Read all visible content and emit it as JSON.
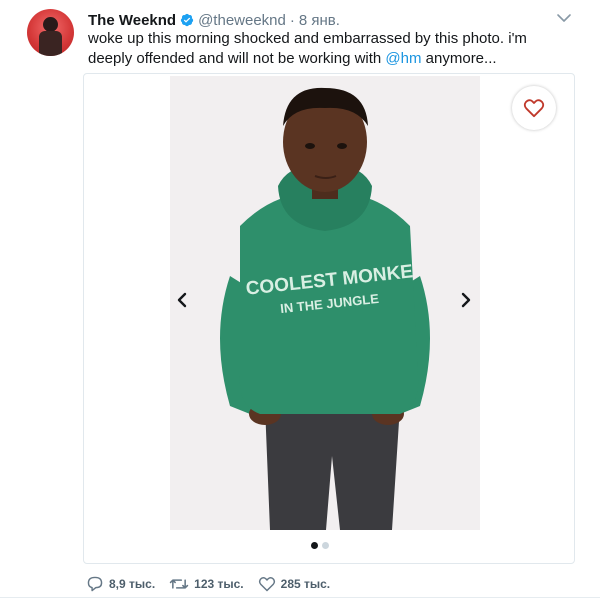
{
  "tweet": {
    "author_name": "The Weeknd",
    "handle": "@theweeknd",
    "separator": "·",
    "date": "8 янв.",
    "text_before": "woke up this morning shocked and embarrassed by this photo. i'm deeply offended and will not be working with ",
    "mention": "@hm",
    "text_after": " anymore..."
  },
  "media": {
    "hoodie_line1": "COOLEST MONKE",
    "hoodie_line2": "IN THE JUNGLE",
    "pages": 2,
    "current_page": 1
  },
  "actions": {
    "replies": "8,9 тыс.",
    "retweets": "123 тыс.",
    "likes": "285 тыс."
  },
  "colors": {
    "accent": "#1b95e0",
    "text": "#14171a",
    "muted": "#657786",
    "hoodie": "#2e8f6b",
    "heart": "#c0392b"
  },
  "icons": [
    "verified-icon",
    "chevron-down-icon",
    "heart-icon",
    "arrow-left-icon",
    "arrow-right-icon",
    "reply-icon",
    "retweet-icon",
    "like-icon"
  ]
}
